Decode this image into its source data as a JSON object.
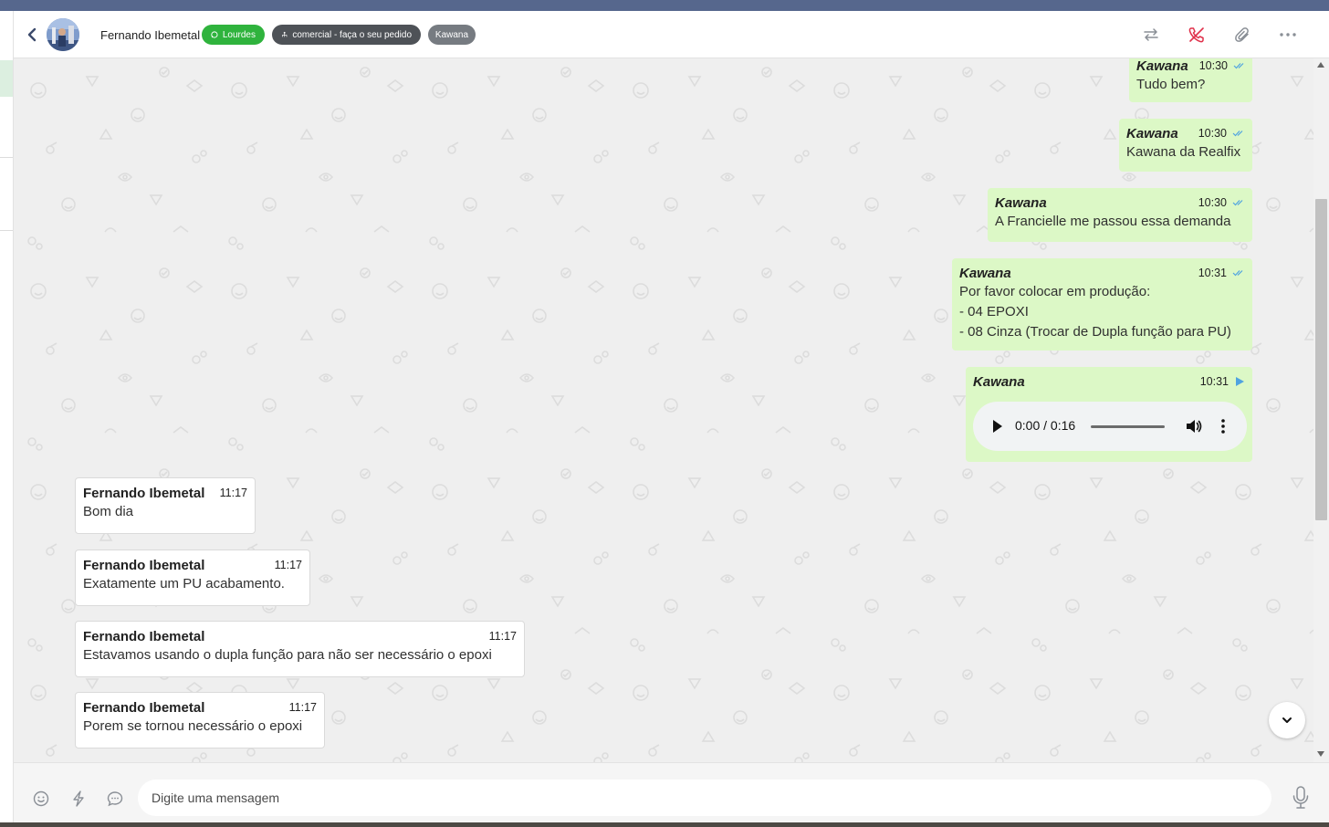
{
  "header": {
    "contact_name": "Fernando Ibemetal",
    "tags": [
      {
        "label": "Lourdes",
        "icon": "whatsapp-icon",
        "color": "#2fb33d"
      },
      {
        "label": "comercial - faça o seu pedido",
        "icon": "sitemap-icon",
        "color": "#4e5257"
      },
      {
        "label": "Kawana",
        "color": "#767b81"
      }
    ],
    "actions": [
      "transfer-icon",
      "end-call-icon",
      "paperclip-icon",
      "more-icon"
    ]
  },
  "messages": {
    "outgoing": [
      {
        "sender": "Kawana",
        "time": "10:30",
        "lines": [
          "Tudo bem?"
        ],
        "status": "read"
      },
      {
        "sender": "Kawana",
        "time": "10:30",
        "lines": [
          "Kawana da Realfix"
        ],
        "status": "read"
      },
      {
        "sender": "Kawana",
        "time": "10:30",
        "lines": [
          "A Francielle me passou essa demanda"
        ],
        "status": "read"
      },
      {
        "sender": "Kawana",
        "time": "10:31",
        "lines": [
          "Por favor colocar em produção:",
          "- 04 EPOXI",
          "- 08 Cinza (Trocar de Dupla função para PU)"
        ],
        "status": "read"
      },
      {
        "sender": "Kawana",
        "time": "10:31",
        "audio": {
          "time": "0:00 / 0:16",
          "progress": 0
        }
      }
    ],
    "incoming": [
      {
        "sender": "Fernando Ibemetal",
        "time": "11:17",
        "text": "Bom dia"
      },
      {
        "sender": "Fernando Ibemetal",
        "time": "11:17",
        "text": "Exatamente um PU acabamento."
      },
      {
        "sender": "Fernando Ibemetal",
        "time": "11:17",
        "text": "Estavamos usando o dupla função para não ser necessário o epoxi"
      },
      {
        "sender": "Fernando Ibemetal",
        "time": "11:17",
        "text": "Porem se tornou necessário o epoxi"
      }
    ]
  },
  "composer": {
    "placeholder": "Digite uma mensagem",
    "icons": [
      "emoji-icon",
      "lightning-icon",
      "quick-reply-icon",
      "microphone-icon"
    ]
  },
  "colors": {
    "outgoing_bubble": "#dcf8c6",
    "incoming_bubble": "#ffffff",
    "read_check": "#4fa3e0",
    "chat_background": "#efefef",
    "topbar": "#56678d"
  }
}
